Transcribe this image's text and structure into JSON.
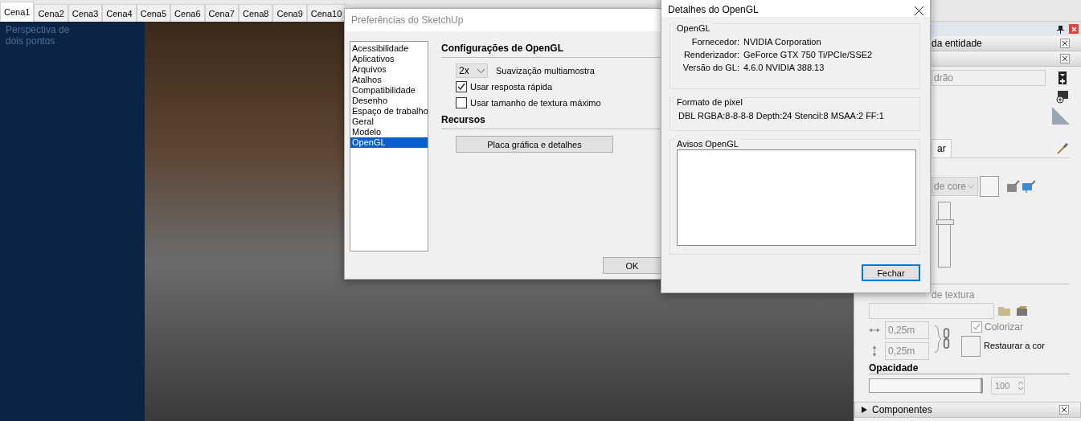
{
  "scene_tabs": [
    {
      "label": "Cena1",
      "selected": true
    },
    {
      "label": "Cena2",
      "selected": false
    },
    {
      "label": "Cena3",
      "selected": false
    },
    {
      "label": "Cena4",
      "selected": false
    },
    {
      "label": "Cena5",
      "selected": false
    },
    {
      "label": "Cena6",
      "selected": false
    },
    {
      "label": "Cena7",
      "selected": false
    },
    {
      "label": "Cena8",
      "selected": false
    },
    {
      "label": "Cena9",
      "selected": false
    },
    {
      "label": "Cena10",
      "selected": false
    }
  ],
  "viewport": {
    "camera_label": "Perspectiva de dois pontos"
  },
  "tray": {
    "entity_title": "da entidade",
    "layer_field": "drão",
    "tab": "ar",
    "color_picker": "de core",
    "brightness": {
      "level": 0.72
    },
    "texture_label": "de textura",
    "width": "0,25m",
    "height": "0,25m",
    "colorize": {
      "label": "Colorizar",
      "checked": true
    },
    "reset_color": "Restaurar a cor",
    "opacity_title": "Opacidade",
    "opacity": {
      "level": 1,
      "value": "100"
    },
    "components_title": "Componentes"
  },
  "preferences": {
    "title": "Preferências do SketchUp",
    "categories": [
      {
        "label": "Acessibilidade",
        "selected": false
      },
      {
        "label": "Aplicativos",
        "selected": false
      },
      {
        "label": "Arquivos",
        "selected": false
      },
      {
        "label": "Atalhos",
        "selected": false
      },
      {
        "label": "Compatibilidade",
        "selected": false
      },
      {
        "label": "Desenho",
        "selected": false
      },
      {
        "label": "Espaço de trabalho",
        "selected": false
      },
      {
        "label": "Geral",
        "selected": false
      },
      {
        "label": "Modelo",
        "selected": false
      },
      {
        "label": "OpenGL",
        "selected": true
      }
    ],
    "heading": "Configurações de OpenGL",
    "multisample": {
      "value": "2x",
      "label": "Suavização multiamostra"
    },
    "options": [
      {
        "label": "Usar resposta rápida",
        "checked": true
      },
      {
        "label": "Usar tamanho de textura máximo",
        "checked": false
      }
    ],
    "resources_heading": "Recursos",
    "details_button": "Placa gráfica e detalhes",
    "ok_button": "OK"
  },
  "opengl_details": {
    "title": "Detalhes do OpenGL",
    "opengl_group": "OpenGL",
    "rows": [
      {
        "label": "Fornecedor:",
        "value": "NVIDIA Corporation"
      },
      {
        "label": "Renderizador:",
        "value": "GeForce GTX 750 Ti/PCIe/SSE2"
      },
      {
        "label": "Versão do GL:",
        "value": "4.6.0 NVIDIA 388.13"
      }
    ],
    "pixel_group": "Formato de pixel",
    "pixel_format": "DBL RGBA:8-8-8-8 Depth:24 Stencil:8 MSAA:2 FF:1",
    "warnings_group": "Avisos OpenGL",
    "close_button": "Fechar"
  }
}
